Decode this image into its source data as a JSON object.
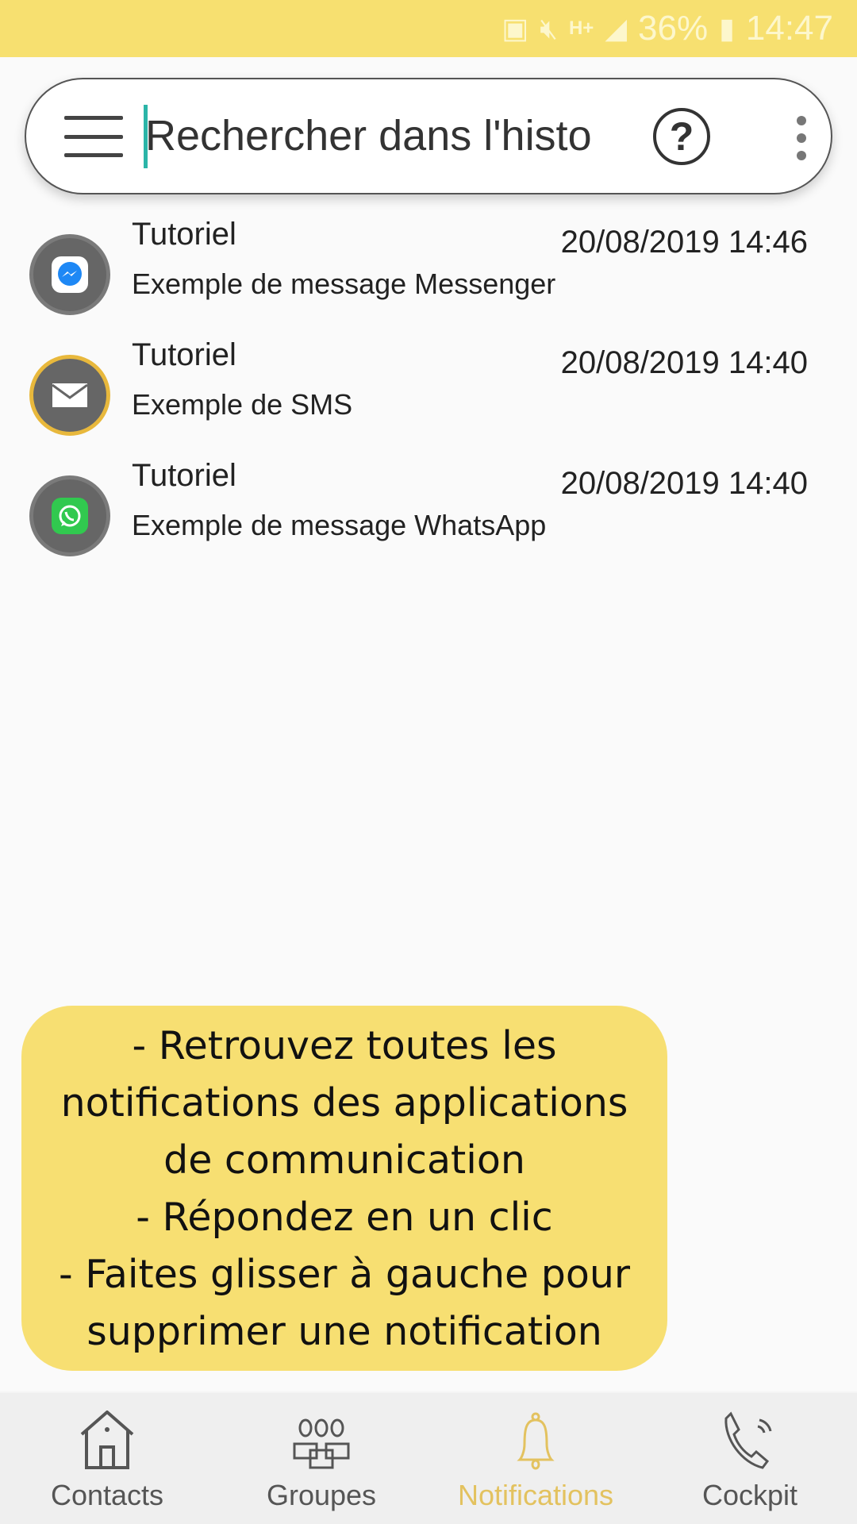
{
  "status_bar": {
    "battery_percent": "36%",
    "time": "14:47",
    "icons": [
      "battery-saver-icon",
      "mute-icon",
      "hplus-network-icon",
      "signal-icon",
      "battery-icon"
    ]
  },
  "search": {
    "placeholder": "Rechercher dans l'histo",
    "help_icon": "?"
  },
  "notifications": [
    {
      "app": "messenger",
      "title": "Tutoriel",
      "date": "20/08/2019 14:46",
      "message": "Exemple de message Messenger"
    },
    {
      "app": "sms",
      "title": "Tutoriel",
      "date": "20/08/2019 14:40",
      "message": "Exemple de SMS"
    },
    {
      "app": "whatsapp",
      "title": "Tutoriel",
      "date": "20/08/2019 14:40",
      "message": "Exemple de message WhatsApp"
    }
  ],
  "tooltip": {
    "lines": [
      "- Retrouvez toutes les",
      "notifications des applications",
      "de communication",
      "- Répondez en un clic",
      "- Faites glisser à gauche pour",
      "supprimer une notification"
    ]
  },
  "nav": {
    "items": [
      {
        "label": "Contacts"
      },
      {
        "label": "Groupes"
      },
      {
        "label": "Notifications",
        "active": true
      },
      {
        "label": "Cockpit"
      }
    ]
  },
  "colors": {
    "accent": "#f7e070",
    "active_tab": "#e3c25f"
  }
}
